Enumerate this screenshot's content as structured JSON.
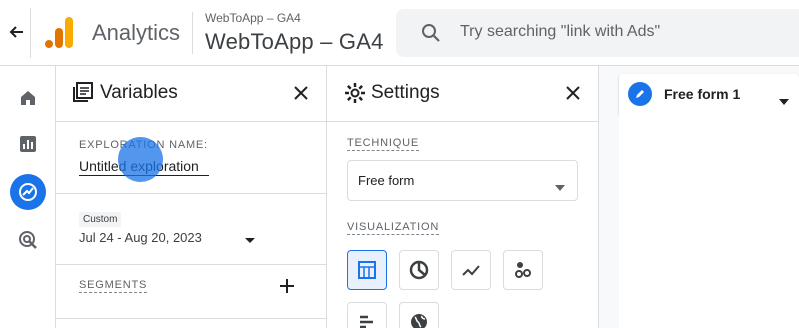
{
  "header": {
    "app_name": "Analytics",
    "account_small": "WebToApp  – GA4",
    "account_big": "WebToApp  – GA4",
    "search_placeholder": "Try searching \"link with Ads\""
  },
  "rail": {
    "items": [
      {
        "name": "home-icon",
        "active": false
      },
      {
        "name": "reports-icon",
        "active": false
      },
      {
        "name": "explore-icon",
        "active": true
      },
      {
        "name": "advertising-icon",
        "active": false
      }
    ]
  },
  "variables_panel": {
    "title": "Variables",
    "exploration_name_label": "EXPLORATION NAME:",
    "exploration_name_value": "Untitled exploration",
    "date_badge": "Custom",
    "date_range": "Jul 24 - Aug 20, 2023",
    "segments_label": "SEGMENTS"
  },
  "settings_panel": {
    "title": "Settings",
    "technique_label": "TECHNIQUE",
    "technique_value": "Free form",
    "visualization_label": "VISUALIZATION",
    "visualizations": [
      "table-icon",
      "donut-chart-icon",
      "line-chart-icon",
      "scatter-icon",
      "bar-chart-icon",
      "geo-map-icon"
    ],
    "active_visualization": "table-icon"
  },
  "canvas": {
    "tab_label": "Free form 1"
  },
  "colors": {
    "accent": "#1a73e8",
    "logo_orange": "#f9ab00",
    "logo_dark_orange": "#e37400"
  }
}
